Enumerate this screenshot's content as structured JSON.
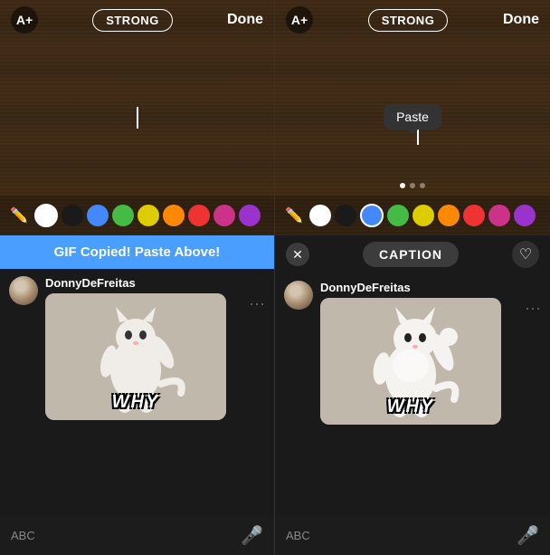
{
  "left_panel": {
    "top_bar": {
      "text_size_label": "A+",
      "style_label": "STRONG",
      "done_label": "Done"
    },
    "colors": [
      {
        "id": "pen",
        "type": "pen"
      },
      {
        "id": "white",
        "hex": "#FFFFFF",
        "selected": true
      },
      {
        "id": "black",
        "hex": "#1a1a1a"
      },
      {
        "id": "blue",
        "hex": "#4488ff"
      },
      {
        "id": "green",
        "hex": "#44bb44"
      },
      {
        "id": "yellow",
        "hex": "#ddcc00"
      },
      {
        "id": "orange",
        "hex": "#ff8800"
      },
      {
        "id": "red",
        "hex": "#ee3333"
      },
      {
        "id": "pink",
        "hex": "#cc3388"
      },
      {
        "id": "purple",
        "hex": "#9933cc"
      }
    ],
    "banner": "GIF Copied! Paste Above!",
    "message": {
      "username": "DonnyDeFreitas",
      "gif_text": "WHY",
      "dots": "···"
    },
    "keyboard": {
      "abc_label": "ABC",
      "mic_label": "🎤"
    }
  },
  "right_panel": {
    "top_bar": {
      "text_size_label": "A+",
      "style_label": "STRONG",
      "done_label": "Done"
    },
    "paste_tooltip": "Paste",
    "colors": [
      {
        "id": "pen",
        "type": "pen"
      },
      {
        "id": "white",
        "hex": "#FFFFFF"
      },
      {
        "id": "black",
        "hex": "#1a1a1a"
      },
      {
        "id": "blue",
        "hex": "#4488ff",
        "selected": true
      },
      {
        "id": "green",
        "hex": "#44bb44"
      },
      {
        "id": "yellow",
        "hex": "#ddcc00"
      },
      {
        "id": "orange",
        "hex": "#ff8800"
      },
      {
        "id": "red",
        "hex": "#ee3333"
      },
      {
        "id": "pink",
        "hex": "#cc3388"
      },
      {
        "id": "purple",
        "hex": "#9933cc"
      }
    ],
    "caption_bar": {
      "close_label": "✕",
      "caption_label": "CAPTION",
      "heart_label": "♡"
    },
    "message": {
      "username": "DonnyDeFreitas",
      "gif_text": "WHY",
      "dots": "···"
    },
    "keyboard": {
      "abc_label": "ABC",
      "mic_label": "🎤"
    }
  }
}
